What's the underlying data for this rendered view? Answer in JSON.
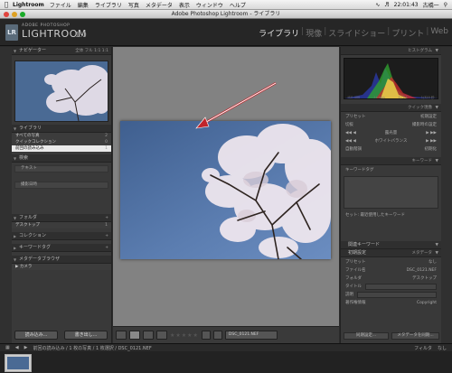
{
  "menubar": {
    "app_name": "Lightroom",
    "items": [
      "ファイル",
      "編集",
      "ライブラリ",
      "写真",
      "メタデータ",
      "表示",
      "ウィンドウ",
      "ヘルプ"
    ],
    "clock": "22:01:43",
    "user": "古橋一"
  },
  "window": {
    "title": "Adobe Photoshop Lightroom - ライブラリ"
  },
  "identity": {
    "brand_small": "ADOBE PHOTOSHOP",
    "brand_big": "LIGHTROOM",
    "version": "1.0",
    "badge": "LR"
  },
  "modules": [
    {
      "label": "ライブラリ",
      "active": true
    },
    {
      "label": "現像",
      "active": false
    },
    {
      "label": "スライドショー",
      "active": false
    },
    {
      "label": "プリント",
      "active": false
    },
    {
      "label": "Web",
      "active": false
    }
  ],
  "left_panel": {
    "navigator": {
      "title": "ナビゲーター",
      "options": "全体  フル  1:1  1:1"
    },
    "library": {
      "title": "ライブラリ",
      "rows": [
        {
          "label": "すべての写真",
          "count": "2"
        },
        {
          "label": "クイックコレクション",
          "count": "0"
        },
        {
          "label": "前回の読み込み",
          "count": "1",
          "selected": true
        }
      ]
    },
    "find": {
      "title": "検索",
      "row1": "テキスト",
      "row2": "撮影日時"
    },
    "folders": {
      "title": "フォルダ",
      "item": "デスクトップ",
      "count": "1"
    },
    "collections": {
      "title": "コレクション"
    },
    "keyword_tags": {
      "title": "キーワードタグ"
    },
    "metadata_browser": {
      "title": "メタデータブラウザ",
      "item": "カメラ"
    },
    "import_button": "読み込み...",
    "export_button": "書き出し..."
  },
  "right_panel": {
    "histogram": {
      "title": "ヒストグラム",
      "labels": [
        "ISO 400",
        "24 mm",
        "f / 7.1",
        "1/320 秒"
      ]
    },
    "quick_develop": {
      "title": "クイック現像",
      "preset_label": "プリセット",
      "preset_value": "初期設定",
      "wb_label": "切抜",
      "wb_value": "撮影時の設定",
      "tone_rows": [
        "露光量",
        "ホワイトバランス",
        "自動階調"
      ],
      "auto_tone": "自動階調",
      "reset": "初期化"
    },
    "keywording": {
      "title": "キーワード",
      "tags_label": "キーワードタグ",
      "recent_label": "セット: 最近使用したキーワード"
    },
    "keyword_set": "関連キーワード",
    "metadata": {
      "title": "メタデータ",
      "mode": "初期設定",
      "preset_label": "プリセット",
      "preset_value": "なし",
      "fields": [
        {
          "label": "ファイル名",
          "value": "DSC_0121.NEF"
        },
        {
          "label": "フォルダ",
          "value": "デスクトップ"
        },
        {
          "label": "タイトル",
          "value": ""
        },
        {
          "label": "説明",
          "value": ""
        },
        {
          "label": "著作権情報",
          "value": "Copyright"
        }
      ]
    },
    "sync_button": "同期設定...",
    "sync_metadata_button": "メタデータを同期..."
  },
  "toolbar": {
    "filename": "DSC_0121.NEF",
    "stars": "★★★★★"
  },
  "filmbar": {
    "info": "前回の読み込み / 1 枚の写真 / 1 枚選択 / DSC_0121.NEF",
    "filter_label": "フィルタ",
    "filter_value": "なし"
  },
  "colors": {
    "accent": "#e6e6e6",
    "sky": "#5b7db0",
    "panel": "#393939"
  }
}
